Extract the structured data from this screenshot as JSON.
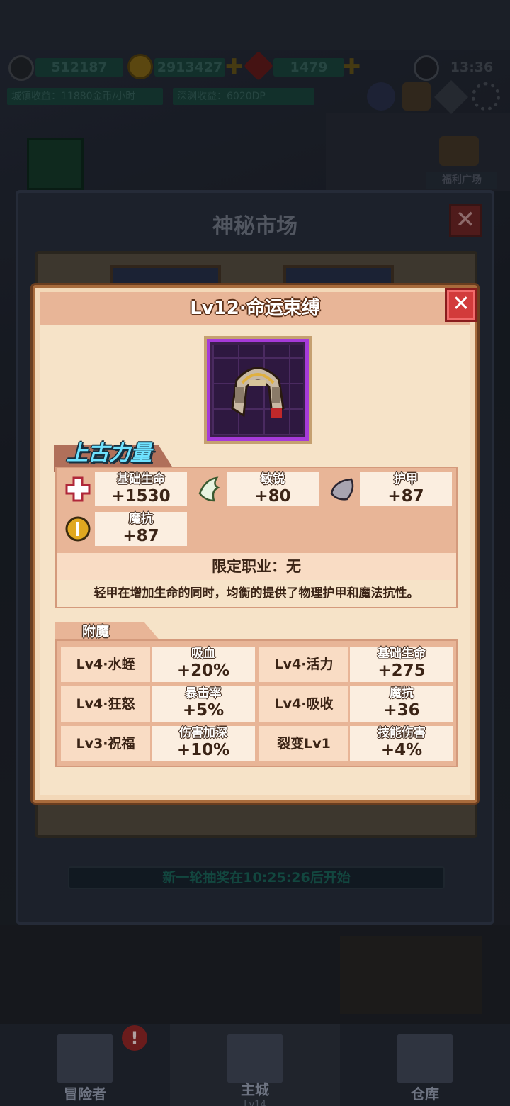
{
  "header": {
    "power": "512187",
    "gold": "2913427",
    "gems": "1479",
    "time": "13:36",
    "town_income": "城镇收益：11880金币/小时",
    "abyss_income": "深渊收益：6020DP",
    "welfare": "福利广场"
  },
  "market": {
    "title": "神秘市场",
    "countdown": "新一轮抽奖在10:25:26后开始"
  },
  "item": {
    "title": "Lv12·命运束缚",
    "tag": "上古力量",
    "stats": [
      {
        "name": "基础生命",
        "value": "+1530",
        "icon": "health-cross-icon"
      },
      {
        "name": "敏锐",
        "value": "+80",
        "icon": "wing-boot-icon"
      },
      {
        "name": "护甲",
        "value": "+87",
        "icon": "armor-shield-icon"
      },
      {
        "name": "魔抗",
        "value": "+87",
        "icon": "magic-resist-icon"
      }
    ],
    "restriction": "限定职业：无",
    "description": "轻甲在增加生命的同时，均衡的提供了物理护甲和魔法抗性。"
  },
  "enchant": {
    "label": "附魔",
    "rows": [
      {
        "name": "Lv4·水蛭",
        "stat": "吸血",
        "value": "+20%"
      },
      {
        "name": "Lv4·活力",
        "stat": "基础生命",
        "value": "+275"
      },
      {
        "name": "Lv4·狂怒",
        "stat": "暴击率",
        "value": "+5%"
      },
      {
        "name": "Lv4·吸收",
        "stat": "魔抗",
        "value": "+36"
      },
      {
        "name": "Lv3·祝福",
        "stat": "伤害加深",
        "value": "+10%"
      },
      {
        "name": "裂变Lv1",
        "stat": "技能伤害",
        "value": "+4%"
      }
    ]
  },
  "nav": {
    "adventurer": "冒险者",
    "main_city": "主城",
    "main_city_level": "Lv14",
    "warehouse": "仓库"
  },
  "colors": {
    "popup_bg": "#f6e3c8",
    "close_red": "#d23b3b",
    "tag_cyan": "#6fe2ff",
    "purple_frame": "#a63ad9"
  }
}
